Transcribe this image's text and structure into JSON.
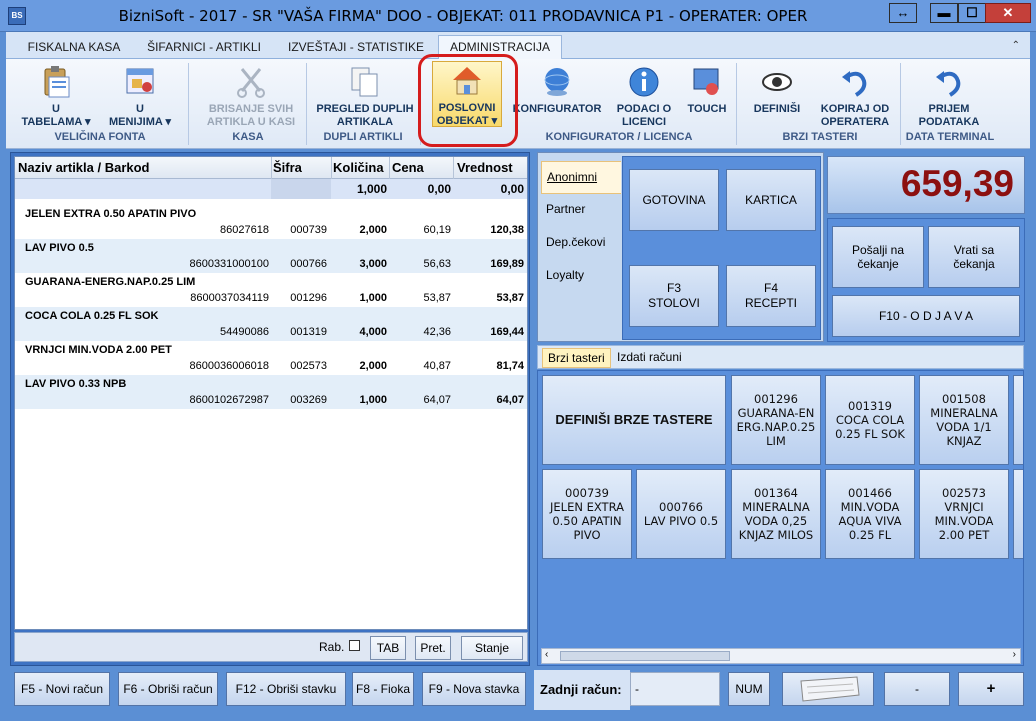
{
  "window": {
    "title": "BizniSoft - 2017 - SR \"VAŠA FIRMA\" DOO - OBJEKAT: 011 PRODAVNICA P1 - OPERATER: OPER",
    "icon": "BS",
    "restore": "↔",
    "minimize": "▬",
    "maximize": "☐",
    "close": "✕"
  },
  "tabs": [
    "FISKALNA KASA",
    "ŠIFARNICI - ARTIKLI",
    "IZVEŠTAJI - STATISTIKE",
    "ADMINISTRACIJA"
  ],
  "ribbon": {
    "buttons": [
      "U\nTABELAMA ▾",
      "U\nMENIJIMA ▾",
      "BRISANJE SVIH\nARTIKLA U KASI",
      "PREGLED DUPLIH\nARTIKALA",
      "POSLOVNI\nOBJEKAT ▾",
      "KONFIGURATOR",
      "PODACI O\nLICENCI",
      "TOUCH",
      "DEFINIŠI",
      "KOPIRAJ OD\nOPERATERA",
      "PRIJEM\nPODATAKA"
    ],
    "groups": [
      "VELIČINA FONTA",
      "KASA",
      "DUPLI ARTIKLI",
      "KONFIGURATOR / LICENCA",
      "BRZI TASTERI",
      "DATA TERMINAL"
    ],
    "collapse": "⌃"
  },
  "grid": {
    "headers": [
      "Naziv artikla / Barkod",
      "Šifra",
      "Količina",
      "Cena",
      "Vrednost"
    ],
    "total": {
      "kolicina": "1,000",
      "cena": "0,00",
      "vrednost": "0,00"
    },
    "rows": [
      {
        "name": "JELEN EXTRA 0.50 APATIN PIVO",
        "barkod": "86027618",
        "sifra": "000739",
        "kolicina": "2,000",
        "cena": "60,19",
        "vrednost": "120,38"
      },
      {
        "name": "LAV PIVO 0.5",
        "barkod": "8600331000100",
        "sifra": "000766",
        "kolicina": "3,000",
        "cena": "56,63",
        "vrednost": "169,89"
      },
      {
        "name": "GUARANA-ENERG.NAP.0.25 LIM",
        "barkod": "8600037034119",
        "sifra": "001296",
        "kolicina": "1,000",
        "cena": "53,87",
        "vrednost": "53,87"
      },
      {
        "name": "COCA COLA 0.25 FL SOK",
        "barkod": "54490086",
        "sifra": "001319",
        "kolicina": "4,000",
        "cena": "42,36",
        "vrednost": "169,44"
      },
      {
        "name": "VRNJCI MIN.VODA 2.00 PET",
        "barkod": "8600036006018",
        "sifra": "002573",
        "kolicina": "2,000",
        "cena": "40,87",
        "vrednost": "81,74"
      },
      {
        "name": "LAV PIVO 0.33 NPB",
        "barkod": "8600102672987",
        "sifra": "003269",
        "kolicina": "1,000",
        "cena": "64,07",
        "vrednost": "64,07"
      }
    ],
    "footer": {
      "rab": "Rab.",
      "tab": "TAB",
      "pret": "Pret.",
      "stanje": "Stanje"
    }
  },
  "customer_tabs": [
    "Anonimni",
    "Partner",
    "Dep.čekovi",
    "Loyalty"
  ],
  "pay": {
    "gotovina": "GOTOVINA",
    "kartica": "KARTICA",
    "stolovi": "F3\nSTOLOVI",
    "recepti": "F4\nRECEPTI"
  },
  "total": "659,39",
  "actions": {
    "posalji": "Pošalji na\nčekanje",
    "vrati": "Vrati sa\nčekanja",
    "odjava": "F10 - O D J A V A"
  },
  "quick_tabs": [
    "Brzi tasteri",
    "Izdati računi"
  ],
  "quick": {
    "define": "DEFINIŠI BRZE TASTERE",
    "buttons": [
      "001296\nGUARANA-EN\nERG.NAP.0.25\nLIM",
      "001319\nCOCA COLA\n0.25 FL SOK",
      "001508\nMINERALNA\nVODA 1/1\nKNJAZ",
      "000739\nJELEN EXTRA\n0.50 APATIN\nPIVO",
      "000766\nLAV PIVO 0.5",
      "001364\nMINERALNA\nVODA 0,25\nKNJAZ MILOS",
      "001466\nMIN.VODA\nAQUA VIVA\n0.25 FL",
      "002573\nVRNJCI\nMIN.VODA\n2.00 PET"
    ]
  },
  "bottom": {
    "buttons": [
      "F5 - Novi račun",
      "F6 - Obriši račun",
      "F12 - Obriši stavku",
      "F8 - Fioka",
      "F9 - Nova stavka"
    ],
    "zadnji_label": "Zadnji račun:",
    "zadnji_val": "-",
    "num": "NUM",
    "minus": "-",
    "plus": "+"
  }
}
